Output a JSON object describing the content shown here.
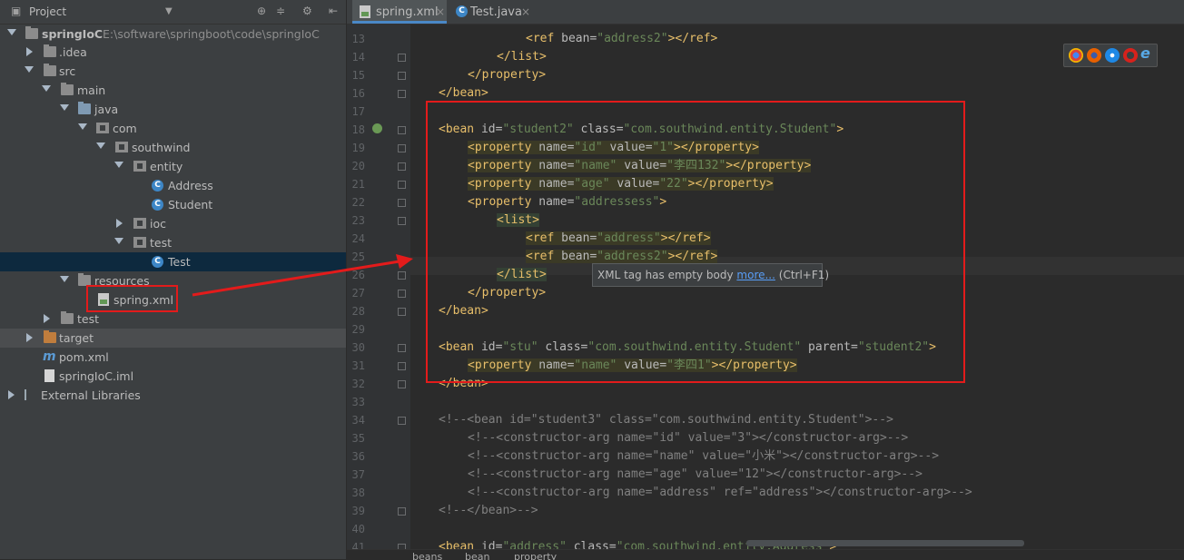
{
  "project_panel": {
    "title": "Project",
    "tree": [
      {
        "label": "springIoC",
        "path": "E:\\software\\springboot\\code\\springIoC"
      },
      {
        "label": ".idea"
      },
      {
        "label": "src"
      },
      {
        "label": "main"
      },
      {
        "label": "java"
      },
      {
        "label": "com"
      },
      {
        "label": "southwind"
      },
      {
        "label": "entity"
      },
      {
        "label": "Address"
      },
      {
        "label": "Student"
      },
      {
        "label": "ioc"
      },
      {
        "label": "test"
      },
      {
        "label": "Test"
      },
      {
        "label": "resources"
      },
      {
        "label": "spring.xml"
      },
      {
        "label": "test"
      },
      {
        "label": "target"
      },
      {
        "label": "pom.xml"
      },
      {
        "label": "springIoC.iml"
      },
      {
        "label": "External Libraries"
      }
    ]
  },
  "tabs": [
    {
      "label": "spring.xml",
      "active": true
    },
    {
      "label": "Test.java",
      "active": false
    }
  ],
  "editor": {
    "lines": [
      {
        "n": "13",
        "code": "<ref bean=\"address2\"></ref>"
      },
      {
        "n": "14",
        "code": "</list>"
      },
      {
        "n": "15",
        "code": "</property>"
      },
      {
        "n": "16",
        "code": "</bean>"
      },
      {
        "n": "17",
        "code": ""
      },
      {
        "n": "18",
        "code": "<bean id=\"student2\" class=\"com.southwind.entity.Student\">"
      },
      {
        "n": "19",
        "code": "<property name=\"id\" value=\"1\"></property>"
      },
      {
        "n": "20",
        "code": "<property name=\"name\" value=\"李四132\"></property>"
      },
      {
        "n": "21",
        "code": "<property name=\"age\" value=\"22\"></property>"
      },
      {
        "n": "22",
        "code": "<property name=\"addressess\">"
      },
      {
        "n": "23",
        "code": "<list>"
      },
      {
        "n": "24",
        "code": "<ref bean=\"address\"></ref>"
      },
      {
        "n": "25",
        "code": "<ref bean=\"address2\"></ref>"
      },
      {
        "n": "26",
        "code": "</list>"
      },
      {
        "n": "27",
        "code": "</property>"
      },
      {
        "n": "28",
        "code": "</bean>"
      },
      {
        "n": "29",
        "code": ""
      },
      {
        "n": "30",
        "code": "<bean id=\"stu\" class=\"com.southwind.entity.Student\" parent=\"student2\">"
      },
      {
        "n": "31",
        "code": "<property name=\"name\" value=\"李四1\"></property>"
      },
      {
        "n": "32",
        "code": "</bean>"
      },
      {
        "n": "33",
        "code": ""
      },
      {
        "n": "34",
        "code": "<!--<bean id=\"student3\" class=\"com.southwind.entity.Student\">-->"
      },
      {
        "n": "35",
        "code": "<!--<constructor-arg name=\"id\" value=\"3\"></constructor-arg>-->"
      },
      {
        "n": "36",
        "code": "<!--<constructor-arg name=\"name\" value=\"小米\"></constructor-arg>-->"
      },
      {
        "n": "37",
        "code": "<!--<constructor-arg name=\"age\" value=\"12\"></constructor-arg>-->"
      },
      {
        "n": "38",
        "code": "<!--<constructor-arg name=\"address\" ref=\"address\"></constructor-arg>-->"
      },
      {
        "n": "39",
        "code": "<!--</bean>-->"
      },
      {
        "n": "40",
        "code": ""
      },
      {
        "n": "41",
        "code": "<bean id=\"address\" class=\"com.southwind.entity.Address\">"
      }
    ],
    "tooltip_text": "XML tag has empty body",
    "tooltip_link": "more...",
    "tooltip_shortcut": "(Ctrl+F1)"
  },
  "breadcrumb": [
    "beans",
    "bean",
    "property"
  ],
  "browser_icons": [
    "chrome-icon",
    "firefox-icon",
    "safari-icon",
    "opera-icon",
    "ie-icon"
  ],
  "colors": {
    "annotation": "#e31b1b",
    "accent": "#4a88c7"
  }
}
